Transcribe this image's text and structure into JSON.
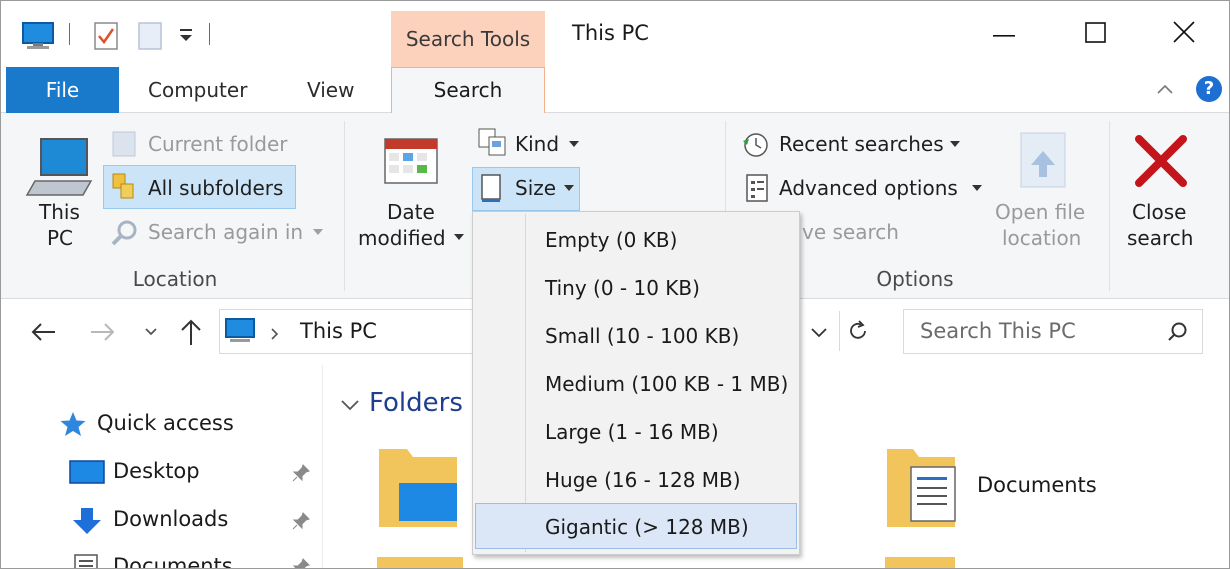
{
  "window": {
    "title": "This PC",
    "contextual_tab_group": "Search Tools"
  },
  "ribbon_tabs": {
    "file": "File",
    "computer": "Computer",
    "view": "View",
    "search": "Search"
  },
  "ribbon": {
    "location": {
      "this_pc_line1": "This",
      "this_pc_line2": "PC",
      "current_folder": "Current folder",
      "all_subfolders": "All subfolders",
      "search_again_in": "Search again in",
      "group_label": "Location"
    },
    "refine": {
      "date_modified_line1": "Date",
      "date_modified_line2": "modified",
      "kind": "Kind",
      "size": "Size"
    },
    "options": {
      "recent_searches": "Recent searches",
      "advanced_options": "Advanced options",
      "save_search_partial": "ve search",
      "open_file_location_line1": "Open file",
      "open_file_location_line2": "location",
      "group_label": "Options"
    },
    "close_search_line1": "Close",
    "close_search_line2": "search"
  },
  "address_bar": {
    "path": "This PC",
    "search_placeholder": "Search This PC"
  },
  "nav_pane": {
    "items": [
      {
        "label": "Quick access",
        "icon": "star-icon"
      },
      {
        "label": "Desktop",
        "icon": "desktop-icon"
      },
      {
        "label": "Downloads",
        "icon": "download-icon"
      },
      {
        "label": "Documents",
        "icon": "documents-icon"
      }
    ]
  },
  "content": {
    "section_title": "Folders",
    "folders": [
      "Documents"
    ]
  },
  "size_dropdown": {
    "options": [
      "Empty (0 KB)",
      "Tiny (0 - 10 KB)",
      "Small (10 - 100 KB)",
      "Medium (100 KB - 1 MB)",
      "Large (1 - 16 MB)",
      "Huge (16 - 128 MB)",
      "Gigantic (> 128 MB)"
    ],
    "highlighted": "Gigantic (> 128 MB)"
  },
  "colors": {
    "file_tab": "#1979ca",
    "contextual_tab": "#fcd2bd",
    "selection": "#cce4f7",
    "close_x": "#c4151c"
  }
}
